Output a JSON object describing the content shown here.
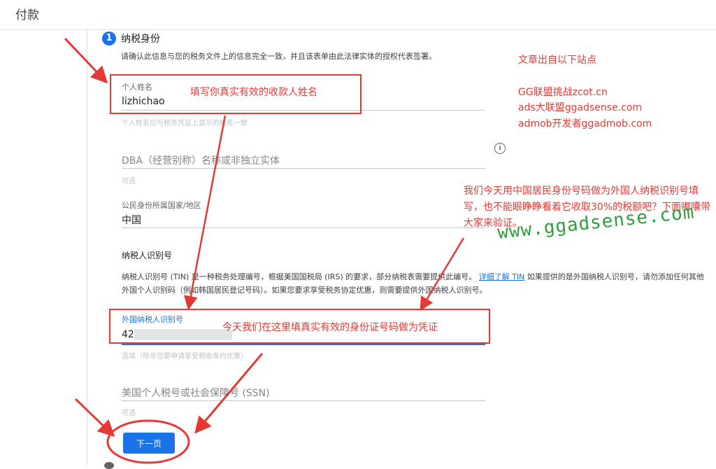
{
  "header": {
    "title": "付款"
  },
  "step": {
    "number": "1",
    "title": "纳税身份"
  },
  "intro_text": "请确认此信息与您的税务文件上的信息完全一致，并且该表单由此法律实体的授权代表签署。",
  "fields": {
    "name": {
      "label": "个人姓名",
      "value": "lizhichao",
      "helper": "个人姓名应与税务凭证上显示的姓名一致"
    },
    "dba": {
      "placeholder": "DBA（经营别称）名称或非独立实体",
      "helper": "可选"
    },
    "country": {
      "label": "公民身份所属国家/地区",
      "value": "中国"
    },
    "foreign_tin": {
      "label": "外国纳税人识别号",
      "value": "42",
      "helper": "选填（除非您要申请享受税收条约优惠）"
    },
    "ssn": {
      "placeholder": "美国个人税号或社会保障号 (SSN)",
      "helper": "可选"
    }
  },
  "tin_section": {
    "heading": "纳税人识别号",
    "desc_before_link": "纳税人识别号 (TIN) 是一种税务处理编号，根据美国国税局 (IRS) 的要求，部分纳税表需要提供此编号。",
    "link_text": "详细了解 TIN",
    "desc_after_link": "如果提供的是外国纳税人识别号，请勿添加任何其他外国个人识别码（例如韩国居民登记号码）。如果您要求享受税务协定优惠，则需要提供外国纳税人识别号。"
  },
  "icons": {
    "info": "info-icon",
    "info_glyph": "i"
  },
  "buttons": {
    "next": "下一页"
  },
  "annotations": {
    "name_note": "填写你真实有效的收款人姓名",
    "tin_note": "今天我们在这里填真实有效的身份证号码做为凭证",
    "source_title": "文章出自以下站点",
    "sites": [
      "GG联盟挑战zcot.cn",
      "ads大联盟ggadsense.com",
      "admob开发者ggadmob.com"
    ],
    "explanation": "我们今天用中国居民身份号码做为外国人纳税识别号填写，也不能眼睁睁看着它收取30%的税额吧？下面嘟囔带大家来验证。",
    "watermark": "www.ggadsense.com"
  },
  "colors": {
    "accent": "#1a73e8",
    "annotation_red": "#e53935",
    "watermark_green": "#2e9e3e"
  }
}
